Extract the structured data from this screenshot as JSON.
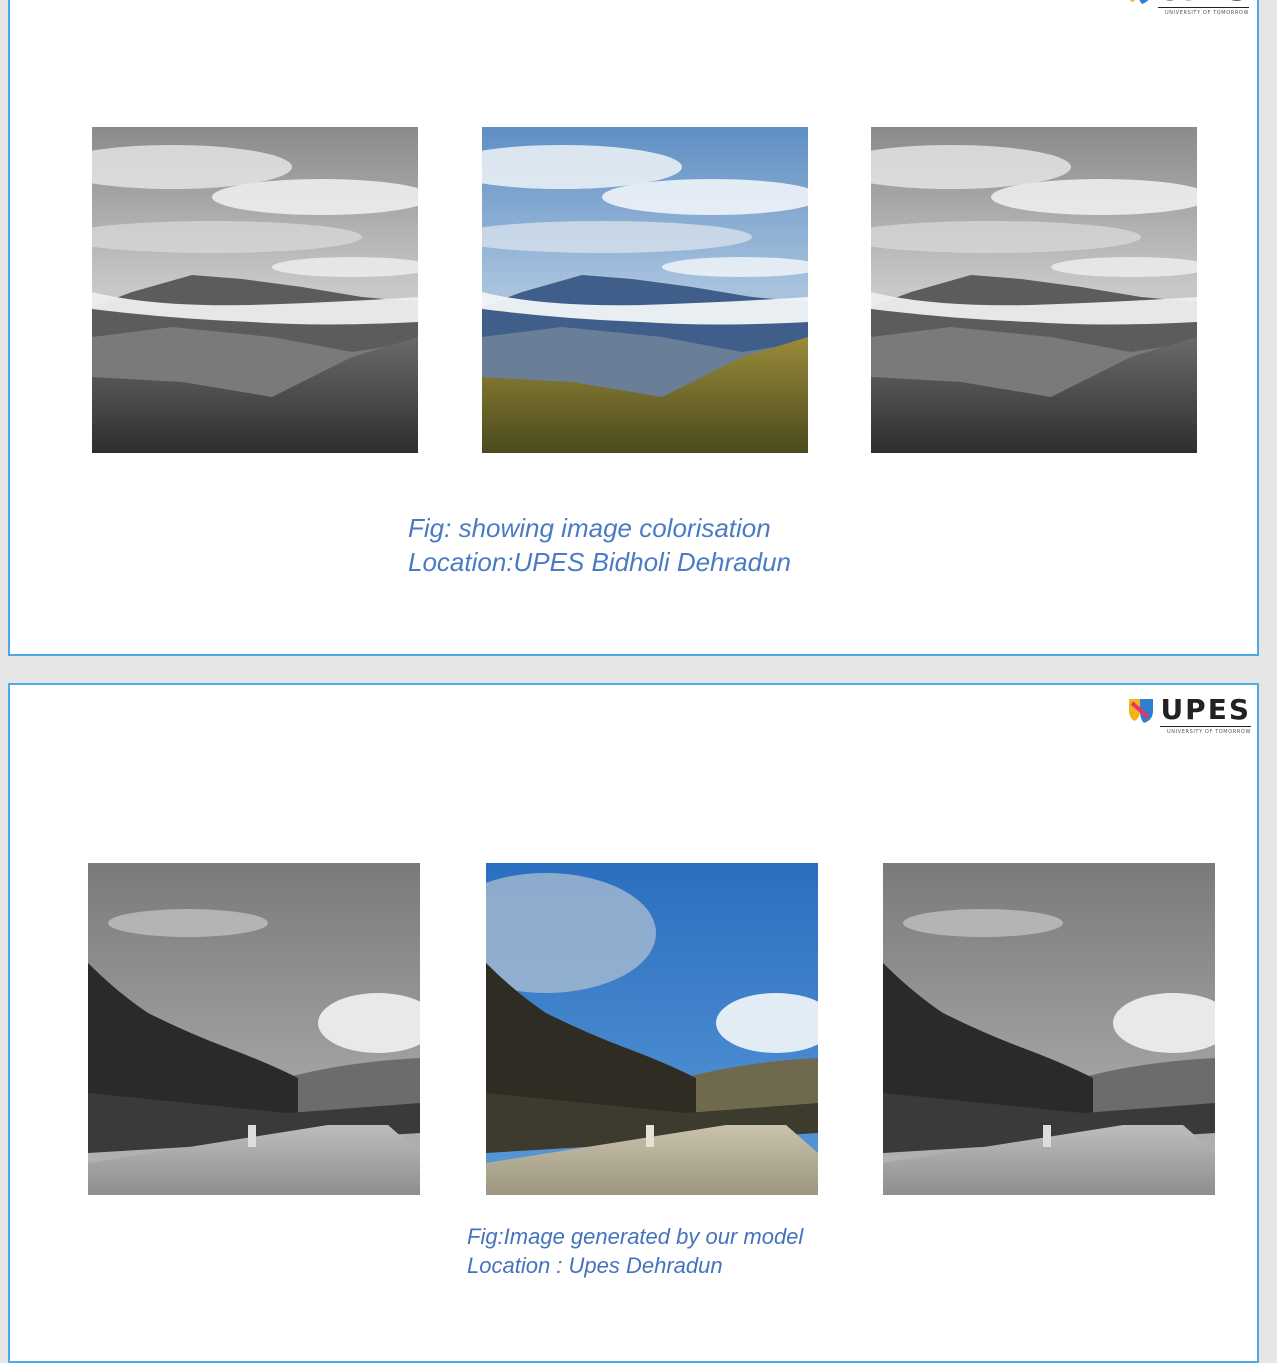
{
  "slides": [
    {
      "logo": {
        "word": "UPES",
        "tagline": "UNIVERSITY OF TOMORROW"
      },
      "figure": {
        "panels": [
          "grayscale-input",
          "colorised-output",
          "grayscale-input"
        ],
        "caption_line1": "Fig: showing image colorisation",
        "caption_line2": "Location:UPES Bidholi Dehradun"
      }
    },
    {
      "logo": {
        "word": "UPES",
        "tagline": "UNIVERSITY OF TOMORROW"
      },
      "figure": {
        "panels": [
          "grayscale-input",
          "colorised-output",
          "grayscale-input"
        ],
        "caption_line1": "Fig:Image generated by our model",
        "caption_line2": "Location : Upes Dehradun"
      }
    }
  ],
  "colors": {
    "border": "#4fa9e6",
    "caption": "#4a7bc4",
    "page_bg": "#e6e6e6"
  },
  "icons": [
    "upes-logo-icon"
  ]
}
